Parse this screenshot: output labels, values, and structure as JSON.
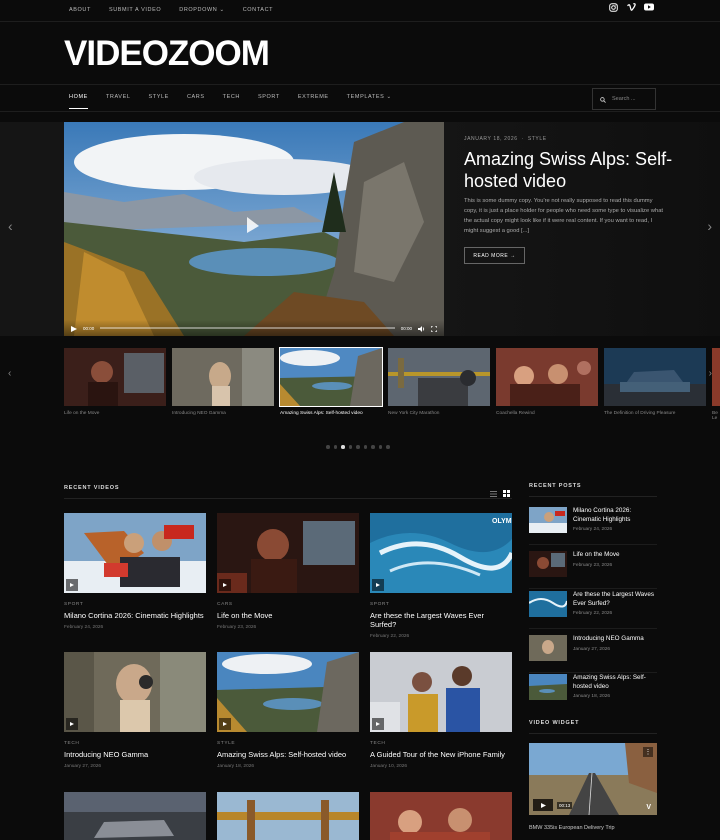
{
  "topbar": {
    "links": [
      "ABOUT",
      "SUBMIT A VIDEO",
      "DROPDOWN",
      "CONTACT"
    ],
    "social_icons": [
      "instagram-icon",
      "vimeo-icon",
      "youtube-icon"
    ]
  },
  "logo": "VIDEOZOOM",
  "nav": {
    "items": [
      "HOME",
      "TRAVEL",
      "STYLE",
      "CARS",
      "TECH",
      "SPORT",
      "EXTREME",
      "TEMPLATES"
    ],
    "search_placeholder": "Search ..."
  },
  "hero": {
    "date": "JANUARY 18, 2026",
    "category": "STYLE",
    "title": "Amazing Swiss Alps: Self-hosted video",
    "excerpt": "This is some dummy copy. You're not really supposed to read this dummy copy, it is just a place holder for people who need some type to visualize what the actual copy might look like if it were real content. If you want to read, I might suggest a good [...]",
    "read_more": "READ MORE →",
    "time_current": "00:00",
    "time_total": "00:00"
  },
  "carousel": {
    "items": [
      {
        "title": "Life on the Move"
      },
      {
        "title": "Introducing NEO Gamma"
      },
      {
        "title": "Amazing Swiss Alps: Self-hosted video"
      },
      {
        "title": "New York City Marathon"
      },
      {
        "title": "Coachella Rewind"
      },
      {
        "title": "The Definition of Driving Pleasure"
      },
      {
        "title": "Be"
      },
      {
        "title": "Le"
      }
    ],
    "dot_count": 9,
    "active_dot": 2
  },
  "recent_videos": {
    "heading": "RECENT VIDEOS",
    "cards": [
      {
        "category": "SPORT",
        "title": "Milano Cortina 2026: Cinematic Highlights",
        "date": "February 24, 2026"
      },
      {
        "category": "CARS",
        "title": "Life on the Move",
        "date": "February 23, 2026"
      },
      {
        "category": "SPORT",
        "title": "Are these the Largest Waves Ever Surfed?",
        "date": "February 22, 2026"
      },
      {
        "category": "TECH",
        "title": "Introducing NEO Gamma",
        "date": "January 27, 2026"
      },
      {
        "category": "STYLE",
        "title": "Amazing Swiss Alps: Self-hosted video",
        "date": "January 18, 2026"
      },
      {
        "category": "TECH",
        "title": "A Guided Tour of the New iPhone Family",
        "date": "January 10, 2026"
      }
    ]
  },
  "recent_posts": {
    "heading": "RECENT POSTS",
    "posts": [
      {
        "title": "Milano Cortina 2026: Cinematic Highlights",
        "date": "February 24, 2026"
      },
      {
        "title": "Life on the Move",
        "date": "February 23, 2026"
      },
      {
        "title": "Are these the Largest Waves Ever Surfed?",
        "date": "February 22, 2026"
      },
      {
        "title": "Introducing NEO Gamma",
        "date": "January 27, 2026"
      },
      {
        "title": "Amazing Swiss Alps: Self-hosted video",
        "date": "January 18, 2026"
      }
    ]
  },
  "video_widget": {
    "heading": "VIDEO WIDGET",
    "caption": "BMW 335is European Delivery Trip",
    "time": "00:13"
  }
}
